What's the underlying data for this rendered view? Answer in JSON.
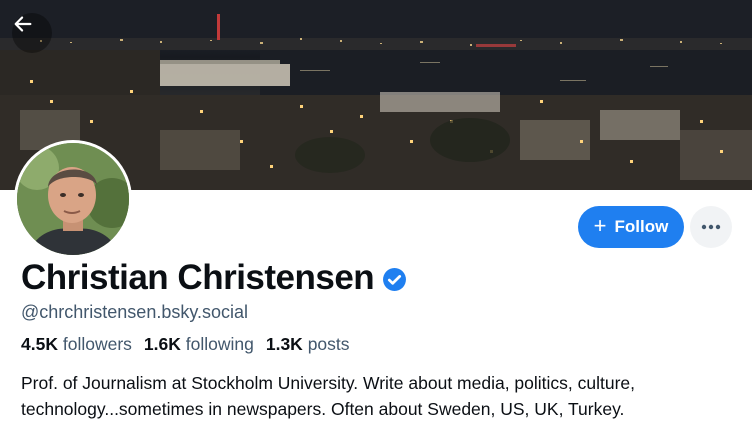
{
  "profile": {
    "display_name": "Christian Christensen",
    "handle": "@chrchristensen.bsky.social",
    "verified": true,
    "bio_line1": "Prof. of Journalism at Stockholm University. Write about media, politics, culture,",
    "bio_line2": "technology...sometimes in newspapers. Often about Sweden, US, UK, Turkey.",
    "stats": {
      "followers_count": "4.5K",
      "followers_label": "followers",
      "following_count": "1.6K",
      "following_label": "following",
      "posts_count": "1.3K",
      "posts_label": "posts"
    }
  },
  "actions": {
    "follow_label": "Follow",
    "follow_icon": "plus-icon",
    "more_icon": "ellipsis-icon",
    "back_icon": "arrow-left-icon"
  },
  "colors": {
    "accent": "#1f7ff0",
    "verified_badge": "#1f7ff0",
    "muted_text": "#42576c",
    "more_button_bg": "#f1f3f5"
  }
}
